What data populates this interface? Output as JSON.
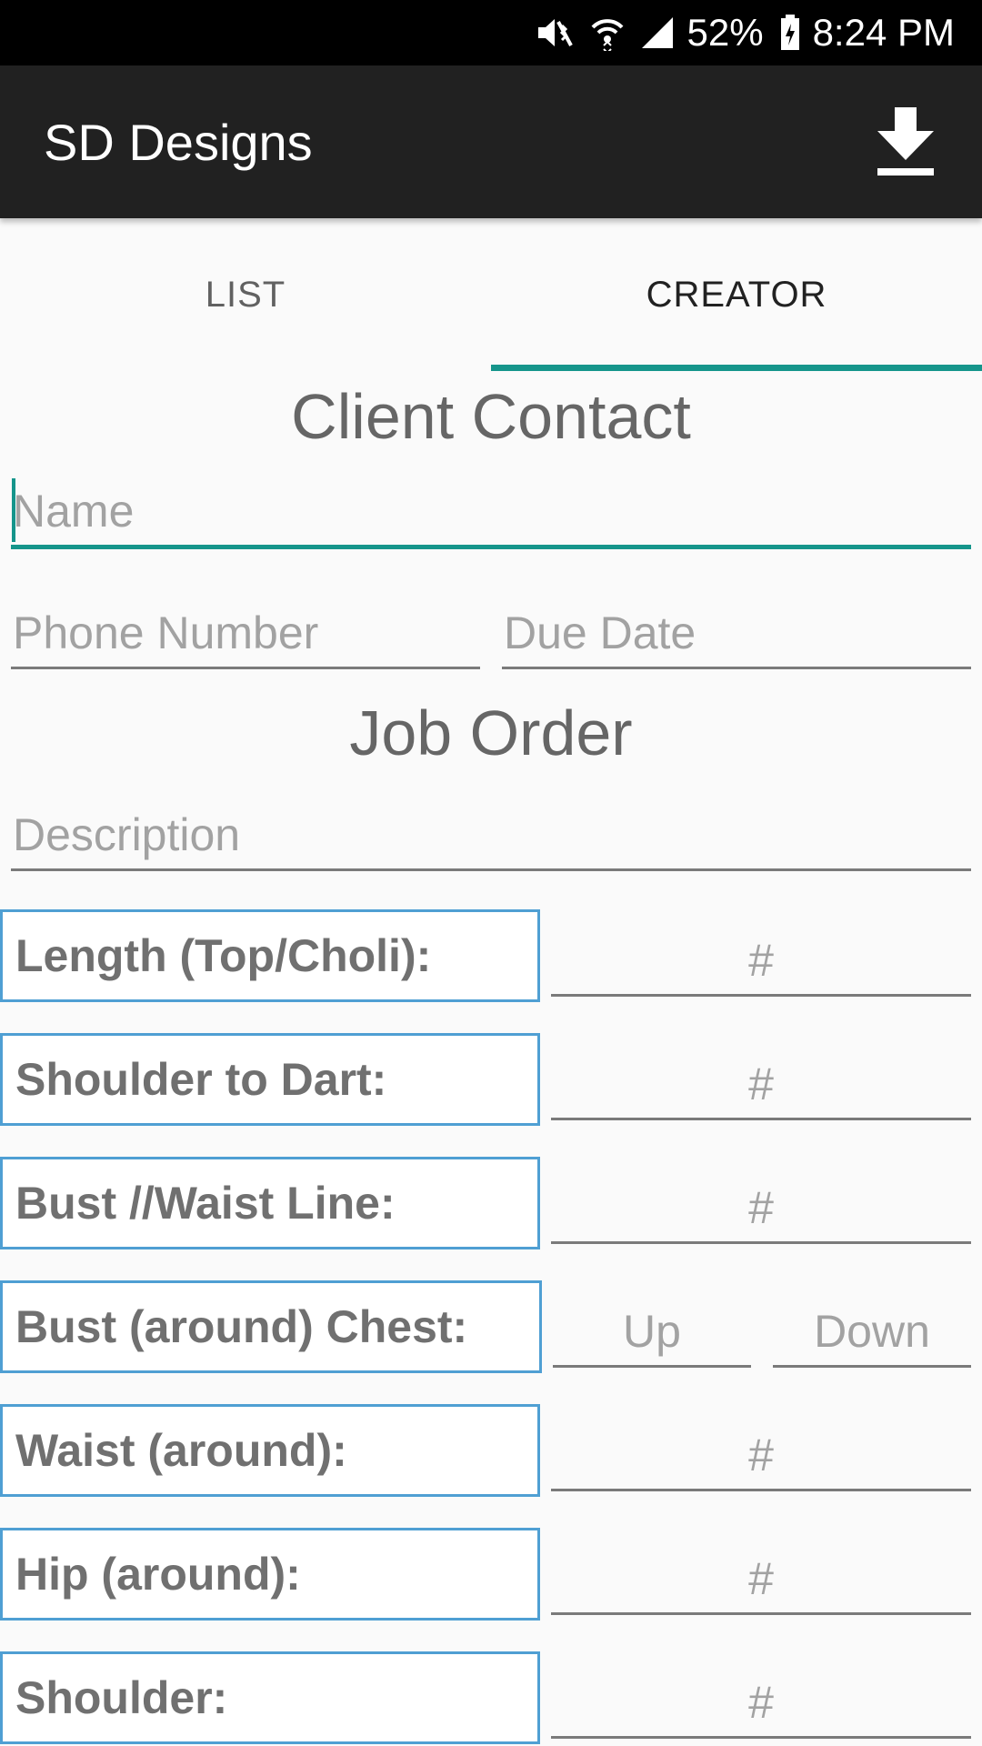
{
  "status_bar": {
    "battery": "52%",
    "time": "8:24 PM",
    "icons": [
      "mute-vibrate-icon",
      "wifi-icon",
      "signal-icon",
      "battery-icon"
    ]
  },
  "app_bar": {
    "title": "SD Designs",
    "action_icon": "download-icon"
  },
  "tabs": [
    {
      "label": "LIST",
      "active": false
    },
    {
      "label": "CREATOR",
      "active": true
    }
  ],
  "client_contact": {
    "heading": "Client Contact",
    "name_placeholder": "Name",
    "phone_placeholder": "Phone Number",
    "due_date_placeholder": "Due Date"
  },
  "job_order": {
    "heading": "Job Order",
    "description_placeholder": "Description"
  },
  "measurements": [
    {
      "label": "Length (Top/Choli):",
      "placeholder": "#"
    },
    {
      "label": "Shoulder to Dart:",
      "placeholder": "#"
    },
    {
      "label": "Bust //Waist Line:",
      "placeholder": "#"
    },
    {
      "label": "Bust (around) Chest:",
      "placeholder_up": "Up",
      "placeholder_down": "Down"
    },
    {
      "label": "Waist (around):",
      "placeholder": "#"
    },
    {
      "label": "Hip (around):",
      "placeholder": "#"
    },
    {
      "label": "Shoulder:",
      "placeholder": "#"
    }
  ],
  "colors": {
    "accent": "#15958b",
    "app_bar": "#212121",
    "label_border": "#4f9fd3"
  }
}
